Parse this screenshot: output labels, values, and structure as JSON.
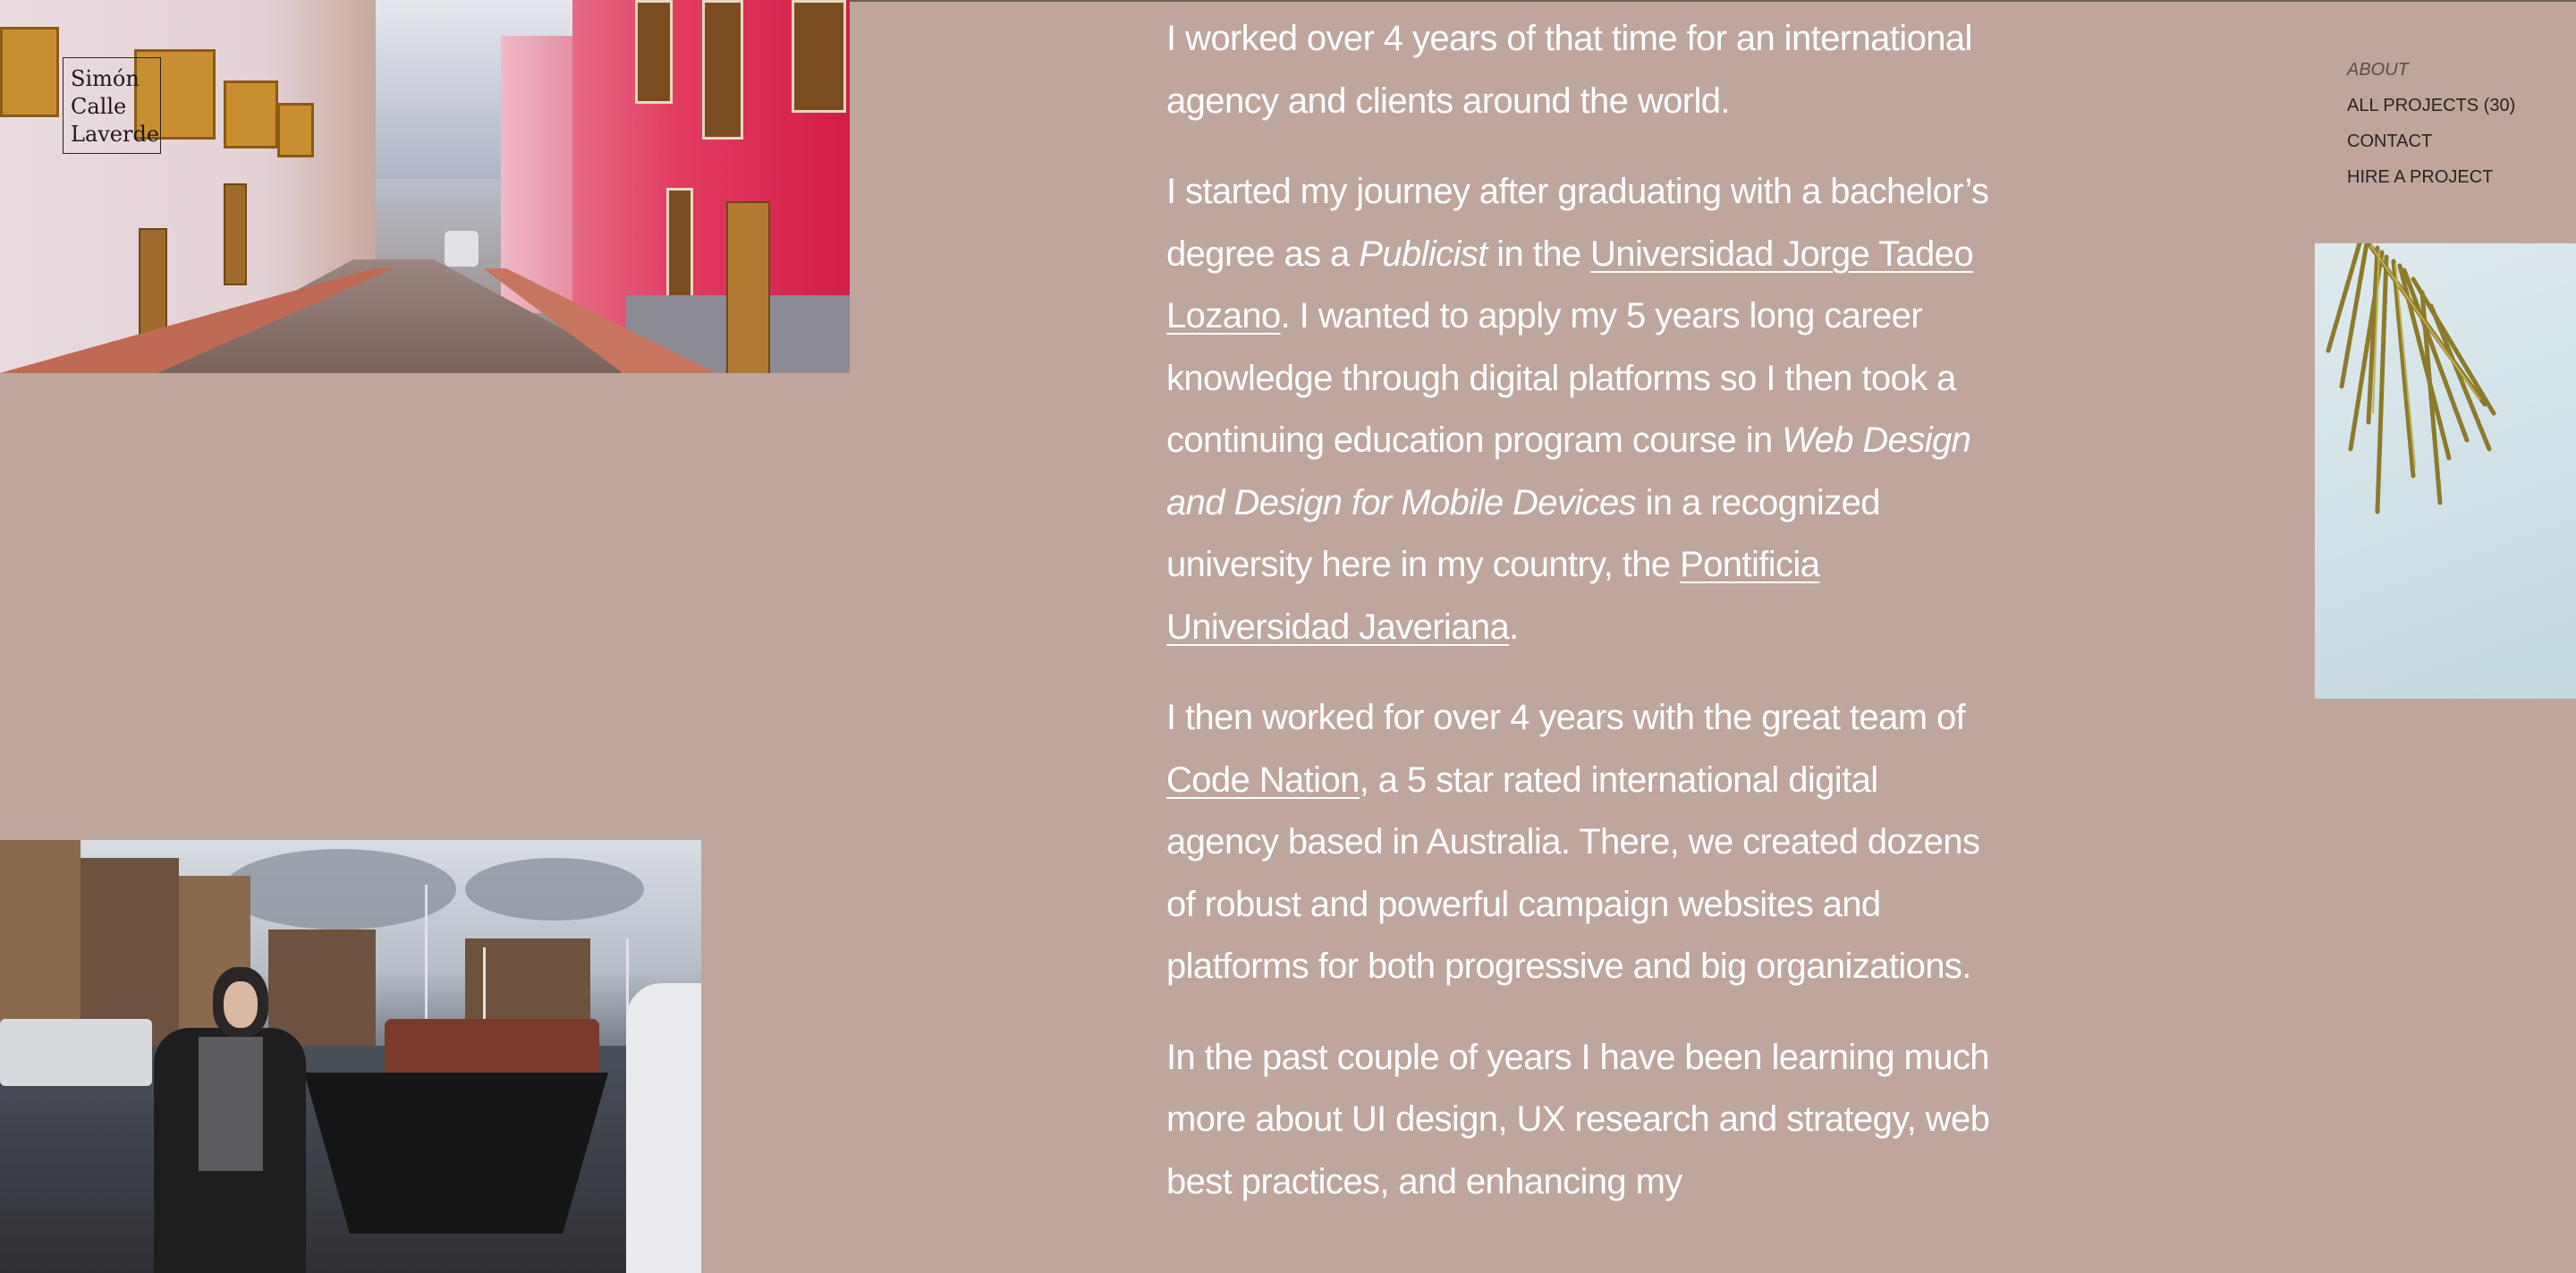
{
  "logo": {
    "lines": [
      "Simón",
      "Calle",
      "Laverde"
    ]
  },
  "nav": {
    "items": [
      {
        "label": "ABOUT",
        "active": true
      },
      {
        "label": "ALL PROJECTS",
        "count": "(30)"
      },
      {
        "label": "CONTACT"
      },
      {
        "label": "HIRE A PROJECT"
      }
    ]
  },
  "article": {
    "p1": "I worked over 4 years of that time for an international agency and clients around the world.",
    "p2": {
      "t1": "I started my journey after graduating with a bachelor’s degree as a ",
      "em1": "Publicist",
      "t2": " in the ",
      "link1": "Universidad Jorge Tadeo Lozano",
      "t3": ". I wanted to apply my 5 years long career knowledge through digital platforms so I then took a continuing education program course in ",
      "em2": "Web Design and Design for Mobile Devices",
      "t4": " in a recognized university here in my country, the ",
      "link2": "Pontificia Universidad Javeriana",
      "t5": "."
    },
    "p3": {
      "t1": "I then worked for over 4 years with the great team of ",
      "link1": "Code Nation",
      "t2": ", a 5 star rated international digital agency based in Australia. There, we created dozens of robust and powerful campaign websites and platforms for both progressive and big organizations."
    },
    "p4": "In the past couple of years I have been learning much more about UI design, UX research and strategy, web best practices, and enhancing my"
  },
  "images": {
    "street": "street-photo",
    "palm": "palm-photo",
    "harbour": "harbour-portrait-photo"
  }
}
